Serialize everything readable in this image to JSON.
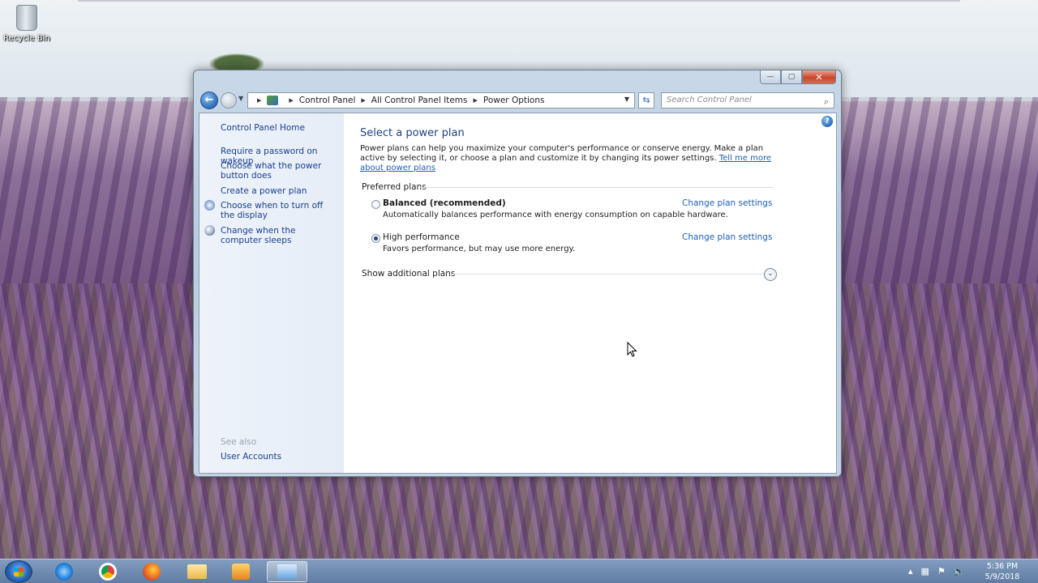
{
  "desktop": {
    "recycle_bin_label": "Recycle Bin"
  },
  "window": {
    "controls": {
      "minimize": "—",
      "maximize": "▢",
      "close": "✕"
    },
    "nav": {
      "back_icon": "arrow-left-icon",
      "forward_icon": "arrow-right-icon"
    },
    "address": {
      "crumbs": [
        "Control Panel",
        "All Control Panel Items",
        "Power Options"
      ]
    },
    "search": {
      "placeholder": "Search Control Panel"
    }
  },
  "left_pane": {
    "home": "Control Panel Home",
    "links": [
      "Require a password on wakeup",
      "Choose what the power button does",
      "Create a power plan",
      "Choose when to turn off the display",
      "Change when the computer sleeps"
    ],
    "see_also_header": "See also",
    "see_also": [
      "User Accounts"
    ]
  },
  "main": {
    "title": "Select a power plan",
    "description": "Power plans can help you maximize your computer's performance or conserve energy. Make a plan active by selecting it, or choose a plan and customize it by changing its power settings.",
    "learn_more_link": "Tell me more about power plans",
    "preferred_header": "Preferred plans",
    "plans": [
      {
        "name": "Balanced (recommended)",
        "description": "Automatically balances performance with energy consumption on capable hardware.",
        "link": "Change plan settings",
        "selected": false
      },
      {
        "name": "High performance",
        "description": "Favors performance, but may use more energy.",
        "link": "Change plan settings",
        "selected": true
      }
    ],
    "additional_plans": "Show additional plans"
  },
  "taskbar": {
    "clock": {
      "time": "5:36 PM",
      "date": "5/9/2018"
    }
  },
  "colors": {
    "link": "#1a3e8c",
    "title": "#1e3f87",
    "close": "#c9462c"
  }
}
